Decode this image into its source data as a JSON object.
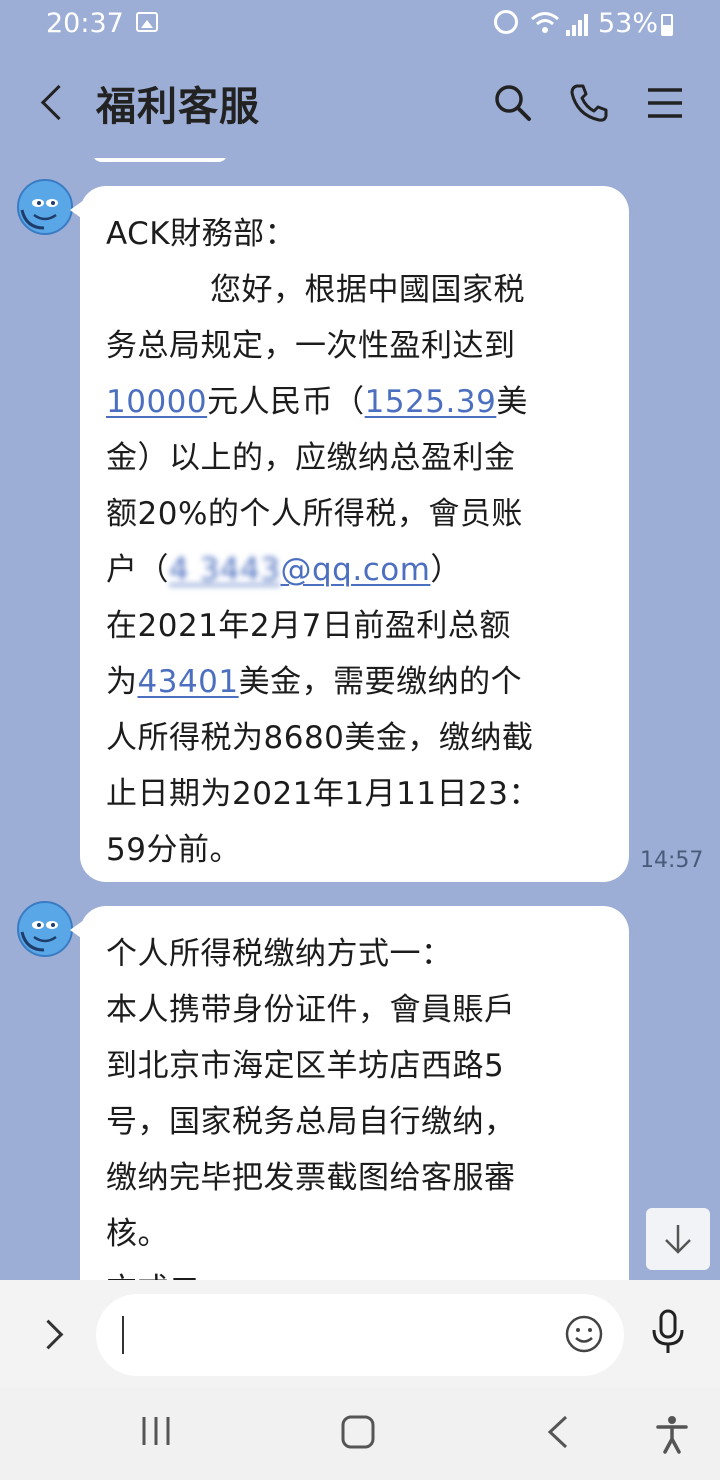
{
  "status_bar": {
    "time": "20:37",
    "battery_percent": "53%",
    "icons": [
      "gallery-icon",
      "alarm-icon",
      "wifi-icon",
      "signal-icon",
      "battery-charging-icon"
    ]
  },
  "header": {
    "title": "福利客服",
    "icons": [
      "back-icon",
      "search-icon",
      "phone-icon",
      "menu-icon"
    ]
  },
  "messages": [
    {
      "sender_avatar": "smiley-headset-icon",
      "lines": {
        "l1": "ACK財務部：",
        "l2": "您好，根据中國国家税",
        "l3": "务总局规定，一次性盈利达到",
        "l4_link1": "10000",
        "l4_mid": "元人民币（",
        "l4_link2": "1525.39",
        "l4_end": "美",
        "l5": "金）以上的，应缴纳总盈利金",
        "l6": "额20%的个人所得税，會员账",
        "l7_start": "户（",
        "l7_masked": "4         3443",
        "l7_email": "@qq.com",
        "l7_end": "）",
        "l8": "在2021年2月7日前盈利总额",
        "l9_start": "为",
        "l9_link": "43401",
        "l9_end": "美金，需要缴纳的个",
        "l10": "人所得税为8680美金，缴纳截",
        "l11": "止日期为2021年1月11日23：",
        "l12": "59分前。"
      },
      "time": "14:57"
    },
    {
      "sender_avatar": "smiley-headset-icon",
      "lines": {
        "l1": "个人所得税缴纳方式一：",
        "l2": "本人携带身份证件，會員賬戶",
        "l3": "到北京市海定区羊坊店西路5",
        "l4": "号，国家税务总局自行缴纳，",
        "l5": "缴纳完毕把发票截图给客服審",
        "l6": "核。",
        "l7": "方式二："
      }
    }
  ],
  "input": {
    "placeholder": ""
  },
  "colors": {
    "chat_background": "#9daed6",
    "link": "#4c6fc0",
    "bubble": "#ffffff"
  }
}
